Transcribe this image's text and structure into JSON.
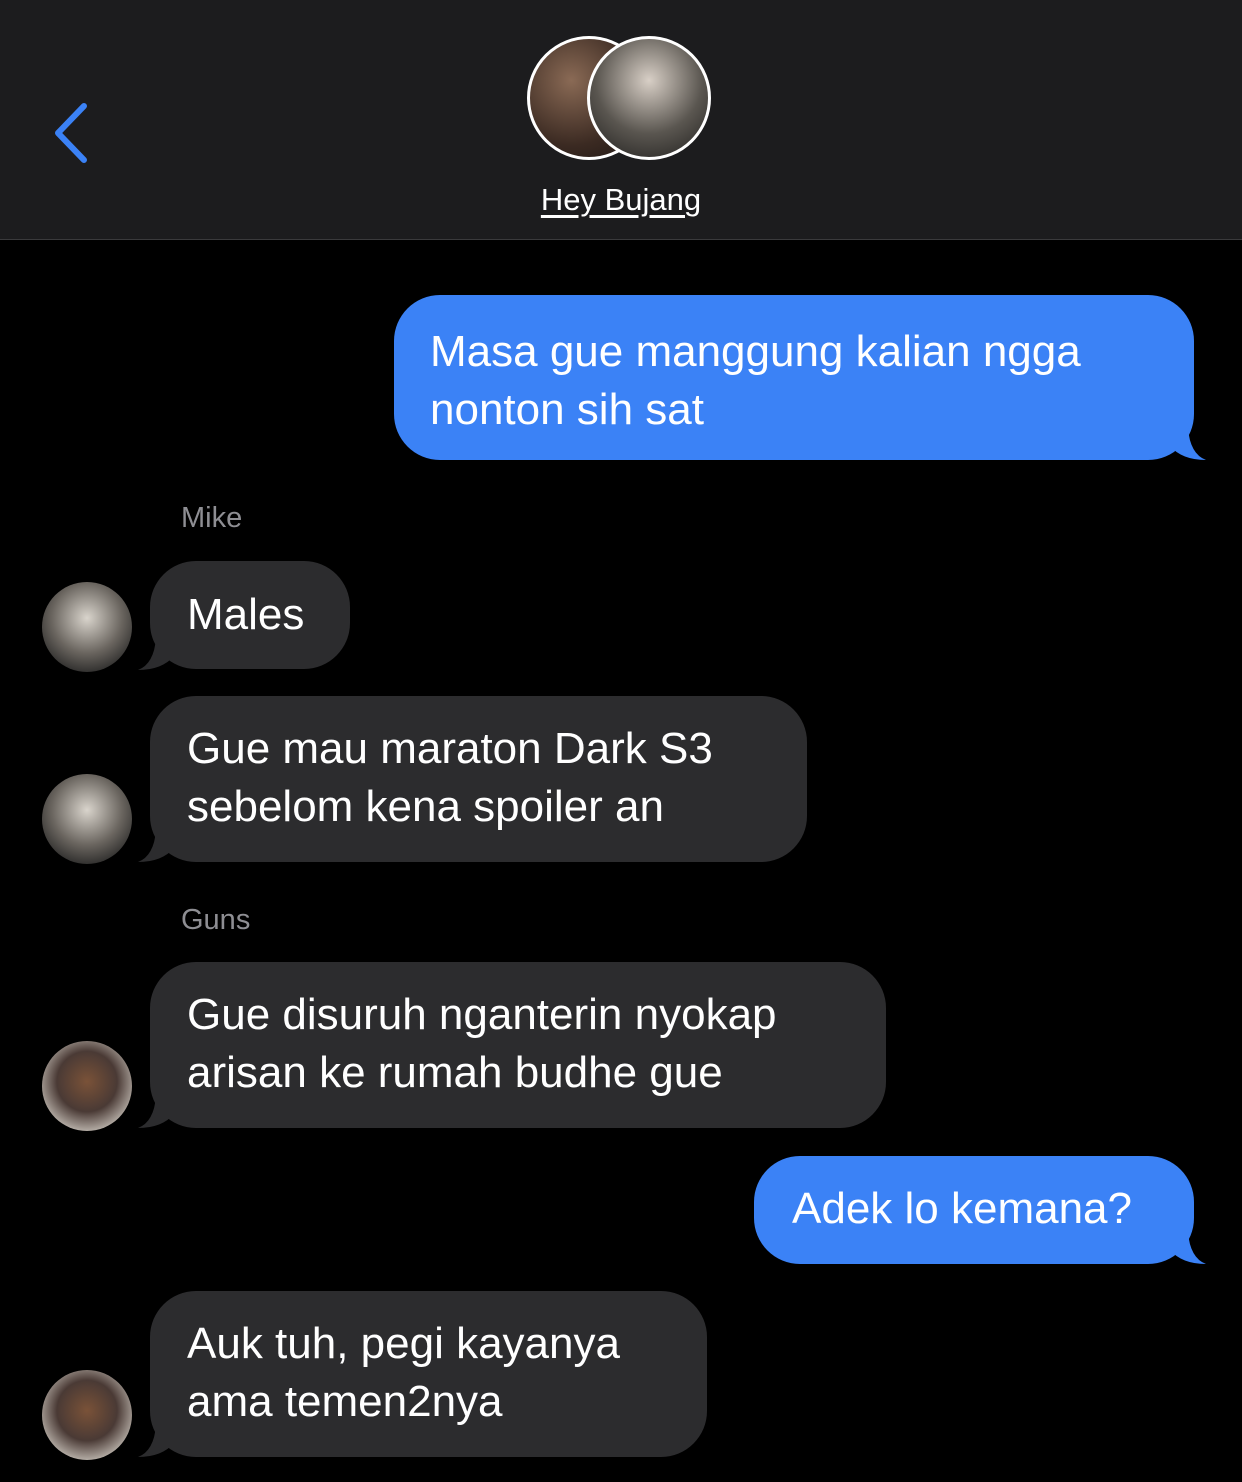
{
  "header": {
    "title": "Hey Bujang",
    "back_icon": "chevron-left-icon",
    "accent_color": "#3b82f6"
  },
  "messages": [
    {
      "direction": "outgoing",
      "text": "Masa gue manggung kalian ngga\nnonton sih sat"
    },
    {
      "sender_label": "Mike"
    },
    {
      "direction": "incoming",
      "sender": "Mike",
      "text": "Males"
    },
    {
      "direction": "incoming",
      "sender": "Mike",
      "text": "Gue mau maraton Dark S3\nsebelom kena spoiler an"
    },
    {
      "sender_label": "Guns"
    },
    {
      "direction": "incoming",
      "sender": "Guns",
      "text": "Gue disuruh nganterin nyokap\narisan ke rumah budhe gue"
    },
    {
      "direction": "outgoing",
      "text": "Adek lo kemana?"
    },
    {
      "direction": "incoming",
      "sender": "Guns",
      "text": "Auk tuh, pegi kayanya\nama temen2nya"
    }
  ],
  "colors": {
    "outgoing_bubble": "#3b82f6",
    "incoming_bubble": "#2c2c2e",
    "header_bg": "#1c1c1e",
    "sender_label": "#8e8e93"
  }
}
